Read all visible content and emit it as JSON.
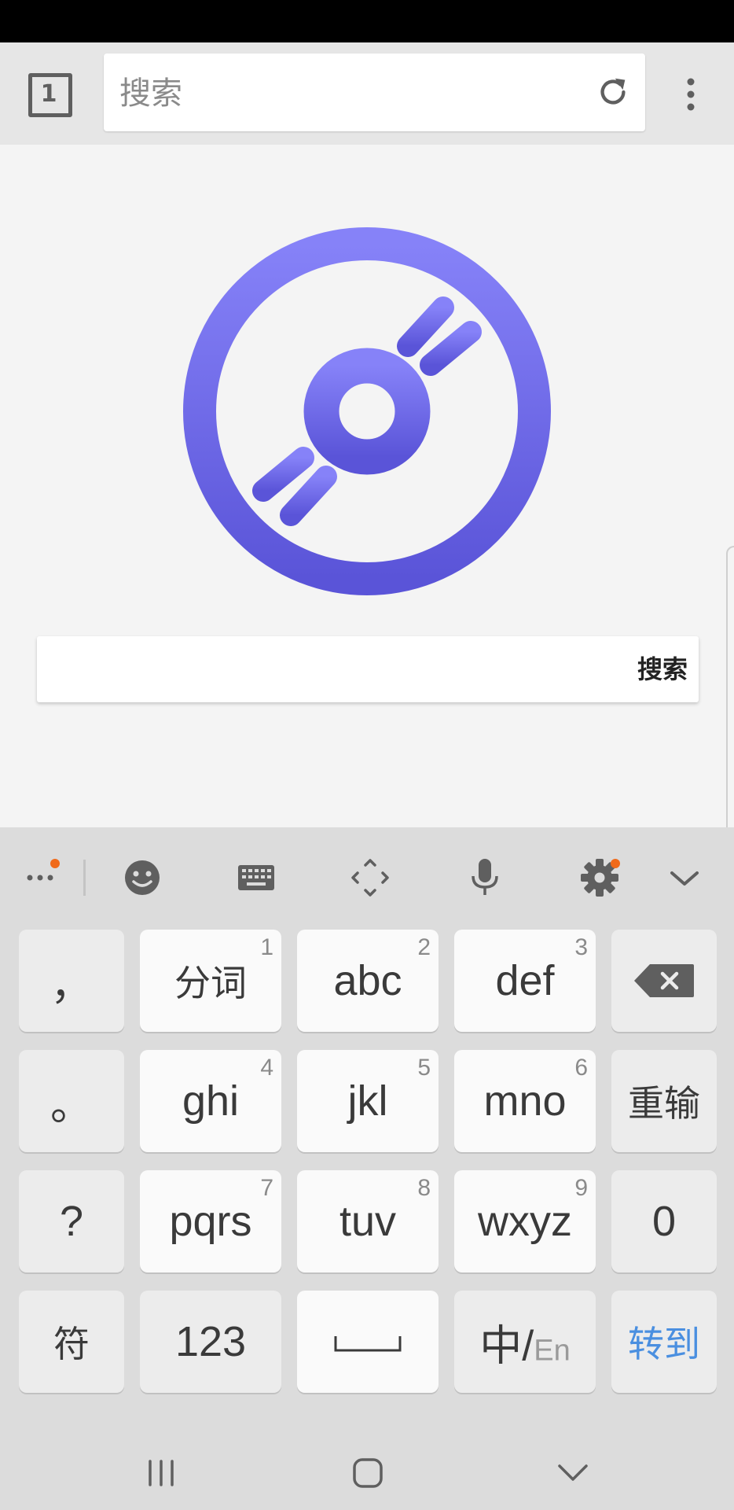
{
  "toolbar": {
    "tab_count": "1",
    "url_placeholder": "搜索",
    "url_value": ""
  },
  "search": {
    "placeholder": "",
    "button_label": "搜索"
  },
  "keyboard": {
    "rows": [
      [
        {
          "label": "，",
          "num": "",
          "style": "gray"
        },
        {
          "label": "分词",
          "num": "1",
          "style": "light"
        },
        {
          "label": "abc",
          "num": "2",
          "style": "light"
        },
        {
          "label": "def",
          "num": "3",
          "style": "light"
        },
        {
          "label": "",
          "num": "",
          "style": "gray",
          "icon": "backspace-icon"
        }
      ],
      [
        {
          "label": "。",
          "num": "",
          "style": "gray"
        },
        {
          "label": "ghi",
          "num": "4",
          "style": "light"
        },
        {
          "label": "jkl",
          "num": "5",
          "style": "light"
        },
        {
          "label": "mno",
          "num": "6",
          "style": "light"
        },
        {
          "label": "重输",
          "num": "",
          "style": "gray"
        }
      ],
      [
        {
          "label": "?",
          "num": "",
          "style": "gray"
        },
        {
          "label": "pqrs",
          "num": "7",
          "style": "light"
        },
        {
          "label": "tuv",
          "num": "8",
          "style": "light"
        },
        {
          "label": "wxyz",
          "num": "9",
          "style": "light"
        },
        {
          "label": "0",
          "num": "",
          "style": "gray"
        }
      ],
      [
        {
          "label": "符",
          "num": "",
          "style": "gray"
        },
        {
          "label": "123",
          "num": "",
          "style": "gray"
        },
        {
          "label": "",
          "num": "",
          "style": "light",
          "icon": "space-icon"
        },
        {
          "label": "中/En",
          "num": "",
          "style": "gray"
        },
        {
          "label": "转到",
          "num": "",
          "style": "gray",
          "accent": true
        }
      ]
    ],
    "lang_primary": "中/",
    "lang_secondary": "En",
    "toolbar_icons": [
      "more-icon",
      "emoji-icon",
      "keyboard-icon",
      "cursor-move-icon",
      "microphone-icon",
      "settings-icon",
      "collapse-icon"
    ]
  },
  "colors": {
    "accent": "#4a8fe0",
    "logo_top": "#8682f8",
    "logo_bottom": "#5a54d8",
    "notification_dot": "#f06a1a"
  }
}
